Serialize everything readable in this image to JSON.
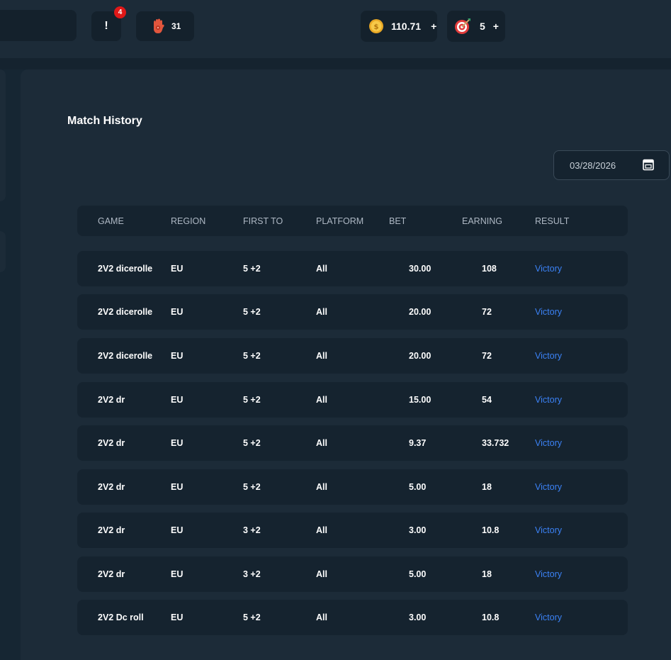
{
  "topbar": {
    "notification_glyph": "!",
    "notification_count": "4",
    "hamsa_count": "31",
    "coin_balance": "110.71",
    "coin_plus": "+",
    "target_count": "5",
    "target_plus": "+"
  },
  "page": {
    "title": "Match History"
  },
  "date_filter": {
    "value": "03/28/2026"
  },
  "table": {
    "headers": [
      "GAME",
      "REGION",
      "FIRST TO",
      "PLATFORM",
      "BET",
      "EARNING",
      "RESULT"
    ],
    "rows": [
      {
        "game": "2V2 dicerolle",
        "region": "EU",
        "first_to": "5 +2",
        "platform": "All",
        "bet": "30.00",
        "earning": "108",
        "result": "Victory"
      },
      {
        "game": "2V2 dicerolle",
        "region": "EU",
        "first_to": "5 +2",
        "platform": "All",
        "bet": "20.00",
        "earning": "72",
        "result": "Victory"
      },
      {
        "game": "2V2 dicerolle",
        "region": "EU",
        "first_to": "5 +2",
        "platform": "All",
        "bet": "20.00",
        "earning": "72",
        "result": "Victory"
      },
      {
        "game": "2V2 dr",
        "region": "EU",
        "first_to": "5 +2",
        "platform": "All",
        "bet": "15.00",
        "earning": "54",
        "result": "Victory"
      },
      {
        "game": "2V2 dr",
        "region": "EU",
        "first_to": "5 +2",
        "platform": "All",
        "bet": "9.37",
        "earning": "33.732",
        "result": "Victory"
      },
      {
        "game": "2V2 dr",
        "region": "EU",
        "first_to": "5 +2",
        "platform": "All",
        "bet": "5.00",
        "earning": "18",
        "result": "Victory"
      },
      {
        "game": "2V2 dr",
        "region": "EU",
        "first_to": "3 +2",
        "platform": "All",
        "bet": "3.00",
        "earning": "10.8",
        "result": "Victory"
      },
      {
        "game": "2V2 dr",
        "region": "EU",
        "first_to": "3 +2",
        "platform": "All",
        "bet": "5.00",
        "earning": "18",
        "result": "Victory"
      },
      {
        "game": "2V2 Dc roll",
        "region": "EU",
        "first_to": "5 +2",
        "platform": "All",
        "bet": "3.00",
        "earning": "10.8",
        "result": "Victory"
      }
    ]
  },
  "colors": {
    "background": "#162633",
    "panel": "#1c2b38",
    "row": "#15232f",
    "result_link": "#3b82f6",
    "badge": "#e01818"
  },
  "icons": [
    "hamsa-icon",
    "coin-icon",
    "target-icon",
    "calendar-icon"
  ]
}
